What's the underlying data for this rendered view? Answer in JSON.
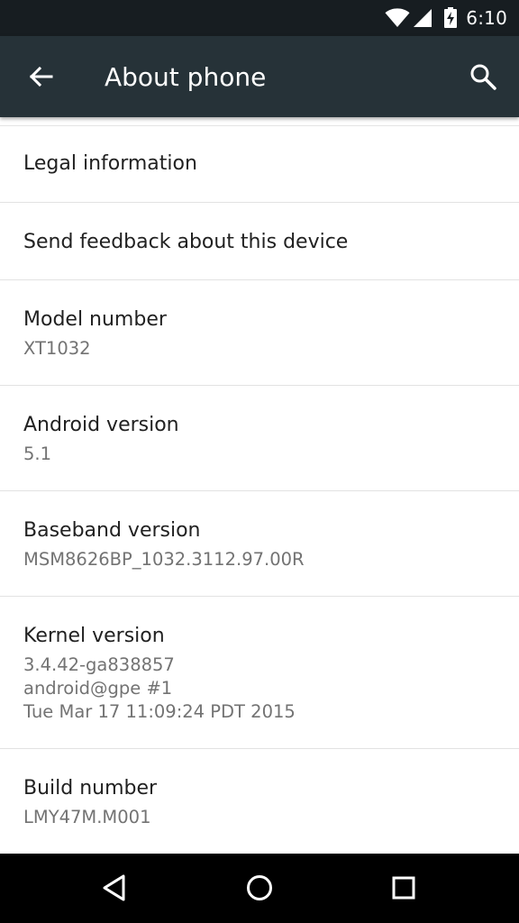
{
  "status_bar": {
    "time": "6:10",
    "icons": [
      "wifi-icon",
      "cell-signal-icon",
      "battery-charging-icon"
    ]
  },
  "app_bar": {
    "title": "About phone",
    "left_icon": "back-arrow-icon",
    "right_icon": "search-icon"
  },
  "items": [
    {
      "label": "Legal information"
    },
    {
      "label": "Send feedback about this device"
    },
    {
      "label": "Model number",
      "value": "XT1032"
    },
    {
      "label": "Android version",
      "value": "5.1"
    },
    {
      "label": "Baseband version",
      "value": "MSM8626BP_1032.3112.97.00R"
    },
    {
      "label": "Kernel version",
      "value": "3.4.42-ga838857\nandroid@gpe #1\nTue Mar 17 11:09:24 PDT 2015"
    },
    {
      "label": "Build number",
      "value": "LMY47M.M001"
    }
  ],
  "nav_bar": {
    "icons": [
      "nav-back-icon",
      "nav-home-icon",
      "nav-recents-icon"
    ]
  },
  "colors": {
    "app_bar": "#263238",
    "status_bar": "#171d21",
    "primary_text": "#212121",
    "secondary_text": "#737373"
  }
}
